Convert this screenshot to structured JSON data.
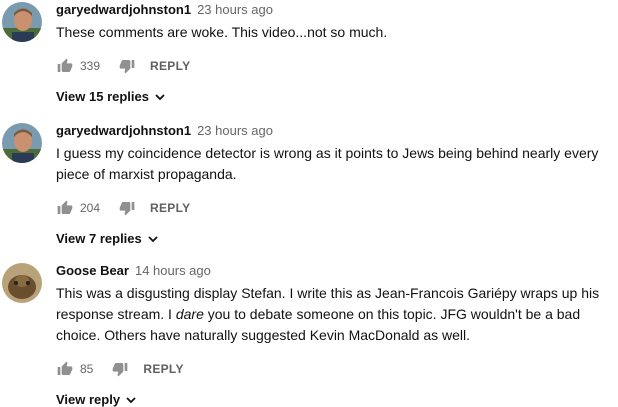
{
  "comments": [
    {
      "author": "garyedwardjohnston1",
      "time": "23 hours ago",
      "text_before": "These comments are woke. This video...not so much.",
      "text_em": "",
      "text_after": "",
      "likes": "339",
      "reply_label": "REPLY",
      "view_replies": "View 15 replies",
      "avatar_icon": "avatar-man-icon"
    },
    {
      "author": "garyedwardjohnston1",
      "time": "23 hours ago",
      "text_before": "I guess my coincidence detector is wrong as it points to Jews being behind nearly every piece of marxist propaganda.",
      "text_em": "",
      "text_after": "",
      "likes": "204",
      "reply_label": "REPLY",
      "view_replies": "View 7 replies",
      "avatar_icon": "avatar-man-icon"
    },
    {
      "author": "Goose Bear",
      "time": "14 hours ago",
      "text_before": "This was a disgusting display Stefan. I write this as Jean-Francois Gariépy wraps up his response stream. I ",
      "text_em": "dare",
      "text_after": " you to debate someone on this topic. JFG wouldn't be a bad choice. Others have naturally suggested Kevin MacDonald as well.",
      "likes": "85",
      "reply_label": "REPLY",
      "view_replies": "View reply",
      "avatar_icon": "avatar-animal-icon"
    }
  ],
  "colors": {
    "text": "#111111",
    "meta": "#666666",
    "icon": "#909090"
  }
}
